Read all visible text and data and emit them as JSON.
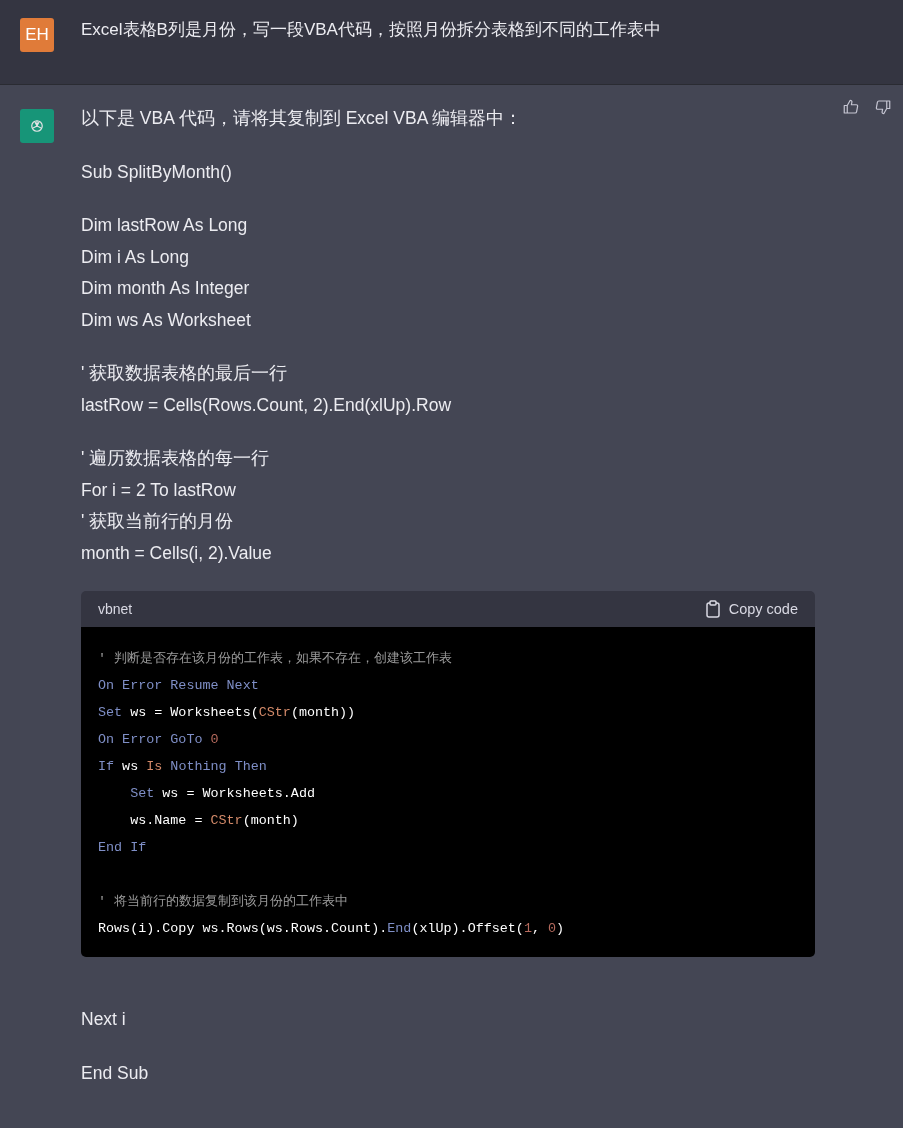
{
  "user_message": {
    "avatar": "EH",
    "text": "Excel表格B列是月份，写一段VBA代码，按照月份拆分表格到不同的工作表中"
  },
  "assistant_message": {
    "blocks": [
      {
        "kind": "paragraph",
        "lines": [
          "以下是 VBA 代码，请将其复制到 Excel VBA 编辑器中："
        ]
      },
      {
        "kind": "paragraph",
        "lines": [
          "Sub SplitByMonth()"
        ]
      },
      {
        "kind": "paragraph",
        "lines": [
          "Dim lastRow As Long",
          "Dim i As Long",
          "Dim month As Integer",
          "Dim ws As Worksheet"
        ]
      },
      {
        "kind": "paragraph",
        "lines": [
          "' 获取数据表格的最后一行",
          "lastRow = Cells(Rows.Count, 2).End(xlUp).Row"
        ]
      },
      {
        "kind": "paragraph",
        "lines": [
          "' 遍历数据表格的每一行",
          "For i = 2 To lastRow",
          "' 获取当前行的月份",
          "month = Cells(i, 2).Value"
        ]
      },
      {
        "kind": "code",
        "language": "vbnet",
        "copy_label": "Copy code",
        "sections": [
          [
            {
              "tokens": [
                {
                  "kind": "comment",
                  "text": "' 判断是否存在该月份的工作表，如果不存在，创建该工作表"
                }
              ]
            },
            {
              "tokens": [
                {
                  "kind": "keyword",
                  "text": "On Error Resume Next"
                }
              ]
            },
            {
              "tokens": [
                {
                  "kind": "keyword",
                  "text": "Set"
                },
                {
                  "kind": "plain",
                  "text": " ws = Worksheets("
                },
                {
                  "kind": "builtin",
                  "text": "CStr"
                },
                {
                  "kind": "plain",
                  "text": "(month))"
                }
              ]
            },
            {
              "tokens": [
                {
                  "kind": "keyword",
                  "text": "On Error GoTo "
                },
                {
                  "kind": "number",
                  "text": "0"
                }
              ]
            },
            {
              "tokens": [
                {
                  "kind": "keyword",
                  "text": "If"
                },
                {
                  "kind": "plain",
                  "text": " ws "
                },
                {
                  "kind": "builtin",
                  "text": "Is"
                },
                {
                  "kind": "keyword",
                  "text": " Nothing Then"
                }
              ]
            },
            {
              "indent": true,
              "tokens": [
                {
                  "kind": "keyword",
                  "text": "Set"
                },
                {
                  "kind": "plain",
                  "text": " ws = Worksheets.Add"
                }
              ]
            },
            {
              "indent": true,
              "tokens": [
                {
                  "kind": "plain",
                  "text": "ws.Name = "
                },
                {
                  "kind": "builtin",
                  "text": "CStr"
                },
                {
                  "kind": "plain",
                  "text": "(month)"
                }
              ]
            },
            {
              "tokens": [
                {
                  "kind": "keyword",
                  "text": "End If"
                }
              ]
            }
          ],
          [
            {
              "tokens": [
                {
                  "kind": "comment",
                  "text": "' 将当前行的数据复制到该月份的工作表中"
                }
              ]
            },
            {
              "tokens": [
                {
                  "kind": "plain",
                  "text": "Rows(i).Copy ws.Rows(ws.Rows.Count)."
                },
                {
                  "kind": "keyword",
                  "text": "End"
                },
                {
                  "kind": "plain",
                  "text": "(xlUp).Offset("
                },
                {
                  "kind": "number",
                  "text": "1"
                },
                {
                  "kind": "plain",
                  "text": ", "
                },
                {
                  "kind": "number",
                  "text": "0"
                },
                {
                  "kind": "plain",
                  "text": ")"
                }
              ]
            }
          ]
        ]
      },
      {
        "kind": "paragraph",
        "lines": [
          "Next i"
        ]
      },
      {
        "kind": "paragraph",
        "lines": [
          "End Sub"
        ]
      }
    ]
  }
}
